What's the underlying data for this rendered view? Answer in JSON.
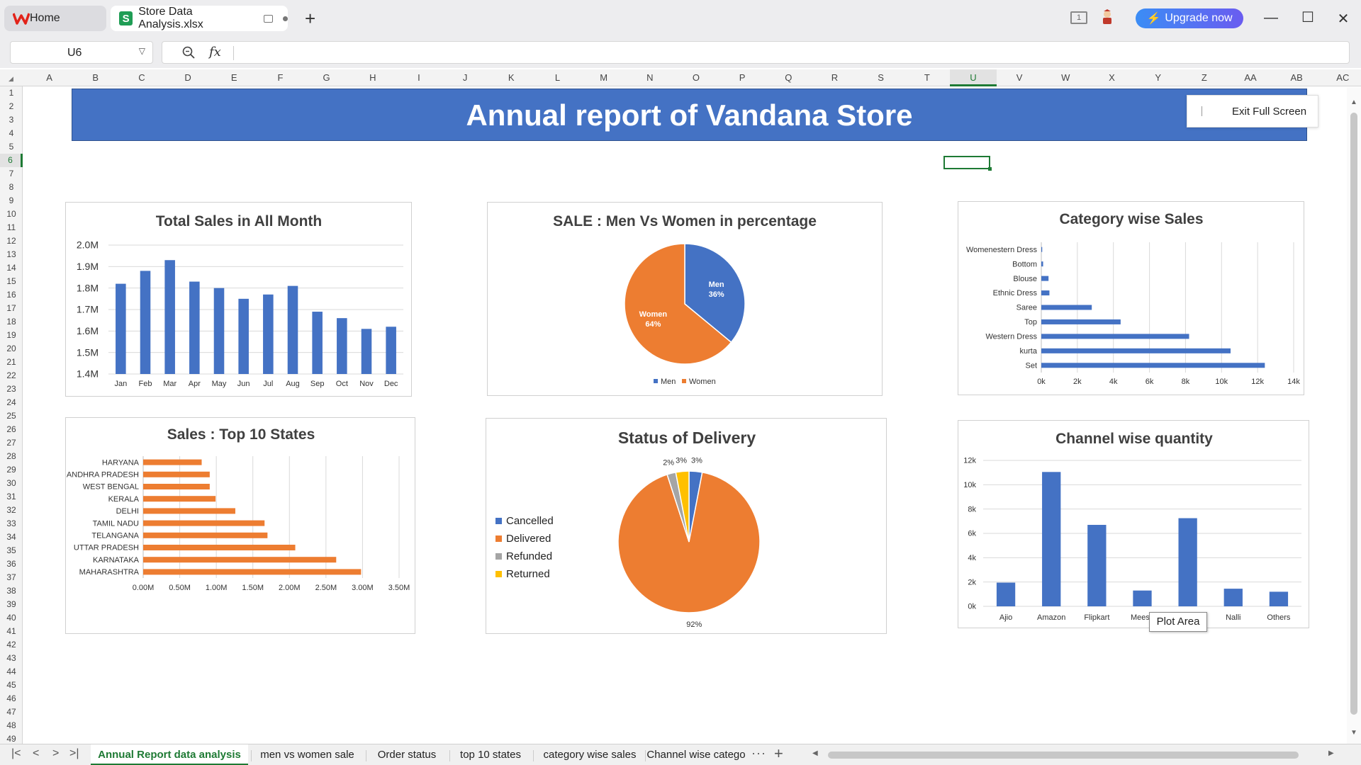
{
  "tabs": {
    "home_label": "Home",
    "file_label": "Store Data Analysis.xlsx",
    "new_tab": "+"
  },
  "topbar": {
    "upgrade_label": "Upgrade now",
    "book_icon_text": "1"
  },
  "formula": {
    "name_box": "U6",
    "fx_label": "fx",
    "value": ""
  },
  "columns": [
    "A",
    "B",
    "C",
    "D",
    "E",
    "F",
    "G",
    "H",
    "I",
    "J",
    "K",
    "L",
    "M",
    "N",
    "O",
    "P",
    "Q",
    "R",
    "S",
    "T",
    "U",
    "V",
    "W",
    "X",
    "Y",
    "Z",
    "AA",
    "AB",
    "AC"
  ],
  "selected_column": "U",
  "rows": [
    "1",
    "2",
    "3",
    "4",
    "5",
    "6",
    "7",
    "8",
    "9",
    "10",
    "11",
    "12",
    "13",
    "14",
    "15",
    "16",
    "17",
    "18",
    "19",
    "20",
    "21",
    "22",
    "23",
    "24",
    "25",
    "26",
    "27",
    "28",
    "29",
    "30",
    "31",
    "32",
    "33",
    "34",
    "35",
    "36",
    "37",
    "38",
    "39",
    "40",
    "41",
    "42",
    "43",
    "44",
    "45",
    "46",
    "47",
    "48",
    "49"
  ],
  "selected_row": "6",
  "banner": {
    "title": "Annual report of Vandana Store"
  },
  "exit_full_screen": "Exit Full Screen",
  "tooltip": "Plot Area",
  "sheet_tabs": [
    {
      "label": "Annual Report data analysis",
      "active": true
    },
    {
      "label": "men vs women sale",
      "active": false
    },
    {
      "label": "Order status",
      "active": false
    },
    {
      "label": "top 10 states",
      "active": false
    },
    {
      "label": "category wise sales",
      "active": false
    },
    {
      "label": "Channel wise catego",
      "active": false
    }
  ],
  "sheet_more": "···",
  "sheet_add": "+",
  "colors": {
    "blue": "#4472c4",
    "orange": "#ed7d31",
    "gray": "#a5a5a5",
    "yellow": "#ffc000",
    "accent_green": "#1e7a34"
  },
  "chart_data": [
    {
      "id": "monthly",
      "type": "bar",
      "title": "Total Sales in All Month",
      "categories": [
        "Jan",
        "Feb",
        "Mar",
        "Apr",
        "May",
        "Jun",
        "Jul",
        "Aug",
        "Sep",
        "Oct",
        "Nov",
        "Dec"
      ],
      "values": [
        1.82,
        1.88,
        1.93,
        1.83,
        1.8,
        1.75,
        1.77,
        1.81,
        1.69,
        1.66,
        1.61,
        1.62
      ],
      "ylim": [
        1.4,
        2.0
      ],
      "yticks": [
        "1.4M",
        "1.5M",
        "1.6M",
        "1.7M",
        "1.8M",
        "1.9M",
        "2.0M"
      ],
      "unit": "M",
      "grid": true
    },
    {
      "id": "gender",
      "type": "pie",
      "title": "SALE : Men Vs Women in percentage",
      "labels": [
        "Men",
        "Women"
      ],
      "values": [
        36,
        64
      ],
      "data_labels": [
        "36%",
        "64%"
      ],
      "legend": "bottom"
    },
    {
      "id": "category",
      "type": "bar",
      "orientation": "horizontal",
      "title": "Category wise Sales",
      "categories": [
        "Womenestern Dress",
        "Bottom",
        "Blouse",
        "Ethnic Dress",
        "Saree",
        "Top",
        "Western Dress",
        "kurta",
        "Set"
      ],
      "values": [
        50,
        100,
        400,
        450,
        2800,
        4400,
        8200,
        10500,
        12400
      ],
      "xlim": [
        0,
        14000
      ],
      "xticks": [
        "0k",
        "2k",
        "4k",
        "6k",
        "8k",
        "10k",
        "12k",
        "14k"
      ],
      "grid": true
    },
    {
      "id": "states",
      "type": "bar",
      "orientation": "horizontal",
      "title": "Sales : Top 10 States",
      "categories": [
        "HARYANA",
        "ANDHRA PRADESH",
        "WEST BENGAL",
        "KERALA",
        "DELHI",
        "TAMIL NADU",
        "TELANGANA",
        "UTTAR PRADESH",
        "KARNATAKA",
        "MAHARASHTRA"
      ],
      "values": [
        0.8,
        0.91,
        0.91,
        0.99,
        1.26,
        1.66,
        1.7,
        2.08,
        2.64,
        2.98
      ],
      "xlim": [
        0,
        3.5
      ],
      "xticks": [
        "0.00M",
        "0.50M",
        "1.00M",
        "1.50M",
        "2.00M",
        "2.50M",
        "3.00M",
        "3.50M"
      ],
      "grid": true
    },
    {
      "id": "delivery",
      "type": "pie",
      "title": "Status of Delivery",
      "labels": [
        "Cancelled",
        "Delivered",
        "Refunded",
        "Returned"
      ],
      "values": [
        3,
        92,
        2,
        3
      ],
      "data_labels": [
        "3%",
        "92%",
        "2%",
        "3%"
      ],
      "legend": "left"
    },
    {
      "id": "channel",
      "type": "bar",
      "title": "Channel wise quantity",
      "categories": [
        "Ajio",
        "Amazon",
        "Flipkart",
        "Meesh",
        "",
        "Nalli",
        "Others"
      ],
      "values": [
        1950,
        11050,
        6700,
        1300,
        7250,
        1450,
        1200
      ],
      "ylim": [
        0,
        12000
      ],
      "yticks": [
        "0k",
        "2k",
        "4k",
        "6k",
        "8k",
        "10k",
        "12k"
      ],
      "grid": true
    }
  ]
}
